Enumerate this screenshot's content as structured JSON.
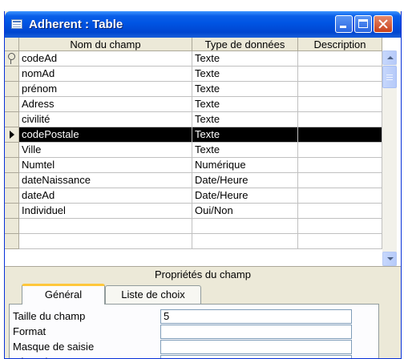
{
  "window": {
    "title": "Adherent : Table"
  },
  "grid": {
    "columns": [
      "Nom du champ",
      "Type de données",
      "Description"
    ],
    "rows": [
      {
        "name": "codeAd",
        "type": "Texte",
        "description": ""
      },
      {
        "name": "nomAd",
        "type": "Texte",
        "description": ""
      },
      {
        "name": "prénom",
        "type": "Texte",
        "description": ""
      },
      {
        "name": "Adress",
        "type": "Texte",
        "description": ""
      },
      {
        "name": "civilité",
        "type": "Texte",
        "description": ""
      },
      {
        "name": "codePostale",
        "type": "Texte",
        "description": ""
      },
      {
        "name": "Ville",
        "type": "Texte",
        "description": ""
      },
      {
        "name": "Numtel",
        "type": "Numérique",
        "description": ""
      },
      {
        "name": "dateNaissance",
        "type": "Date/Heure",
        "description": ""
      },
      {
        "name": "dateAd",
        "type": "Date/Heure",
        "description": ""
      },
      {
        "name": "Individuel",
        "type": "Oui/Non",
        "description": ""
      },
      {
        "name": "",
        "type": "",
        "description": ""
      },
      {
        "name": "",
        "type": "",
        "description": ""
      }
    ],
    "primary_key_row": 0,
    "current_row": 5
  },
  "properties": {
    "title": "Propriétés du champ",
    "tabs": [
      "Général",
      "Liste de choix"
    ],
    "active_tab": 0,
    "fields": [
      {
        "label": "Taille du champ",
        "value": "5"
      },
      {
        "label": "Format",
        "value": ""
      },
      {
        "label": "Masque de saisie",
        "value": ""
      },
      {
        "label": "Légende",
        "value": ""
      }
    ]
  },
  "icons": [
    "table-icon",
    "primary-key-icon",
    "row-pointer-icon",
    "minimize-icon",
    "maximize-icon",
    "close-icon",
    "scroll-up-icon",
    "scroll-down-icon"
  ],
  "colors": {
    "titlebar": "#0054e3",
    "current_row": "#000000",
    "close_button": "#c8401a",
    "tab_highlight": "#ffc73c"
  }
}
